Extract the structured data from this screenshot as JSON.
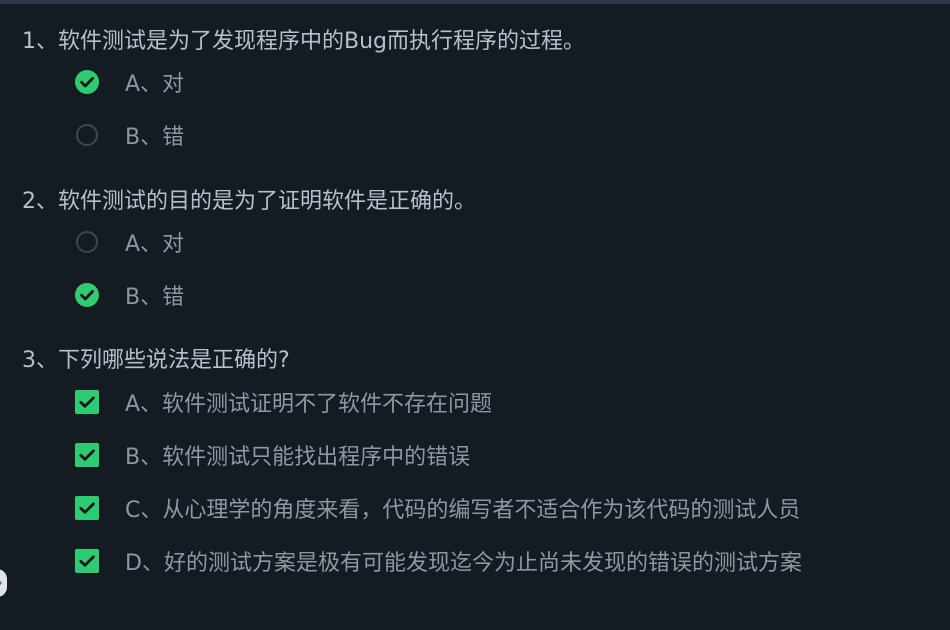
{
  "colors": {
    "background": "#141b22",
    "question_text": "#b7c0c9",
    "option_text": "#8e98a3",
    "selected_accent": "#2ecc71",
    "unselected_border": "#3f4852"
  },
  "questions": [
    {
      "text": "1、软件测试是为了发现程序中的Bug而执行程序的过程。",
      "type": "single",
      "options": [
        {
          "label": "A、对",
          "selected": true
        },
        {
          "label": "B、错",
          "selected": false
        }
      ]
    },
    {
      "text": "2、软件测试的目的是为了证明软件是正确的。",
      "type": "single",
      "options": [
        {
          "label": "A、对",
          "selected": false
        },
        {
          "label": "B、错",
          "selected": true
        }
      ]
    },
    {
      "text": "3、下列哪些说法是正确的?",
      "type": "multiple",
      "options": [
        {
          "label": "A、软件测试证明不了软件不存在问题",
          "selected": true
        },
        {
          "label": "B、软件测试只能找出程序中的错误",
          "selected": true
        },
        {
          "label": "C、从心理学的角度来看，代码的编写者不适合作为该代码的测试人员",
          "selected": true
        },
        {
          "label": "D、好的测试方案是极有可能发现迄今为止尚未发现的错误的测试方案",
          "selected": true
        }
      ]
    }
  ]
}
